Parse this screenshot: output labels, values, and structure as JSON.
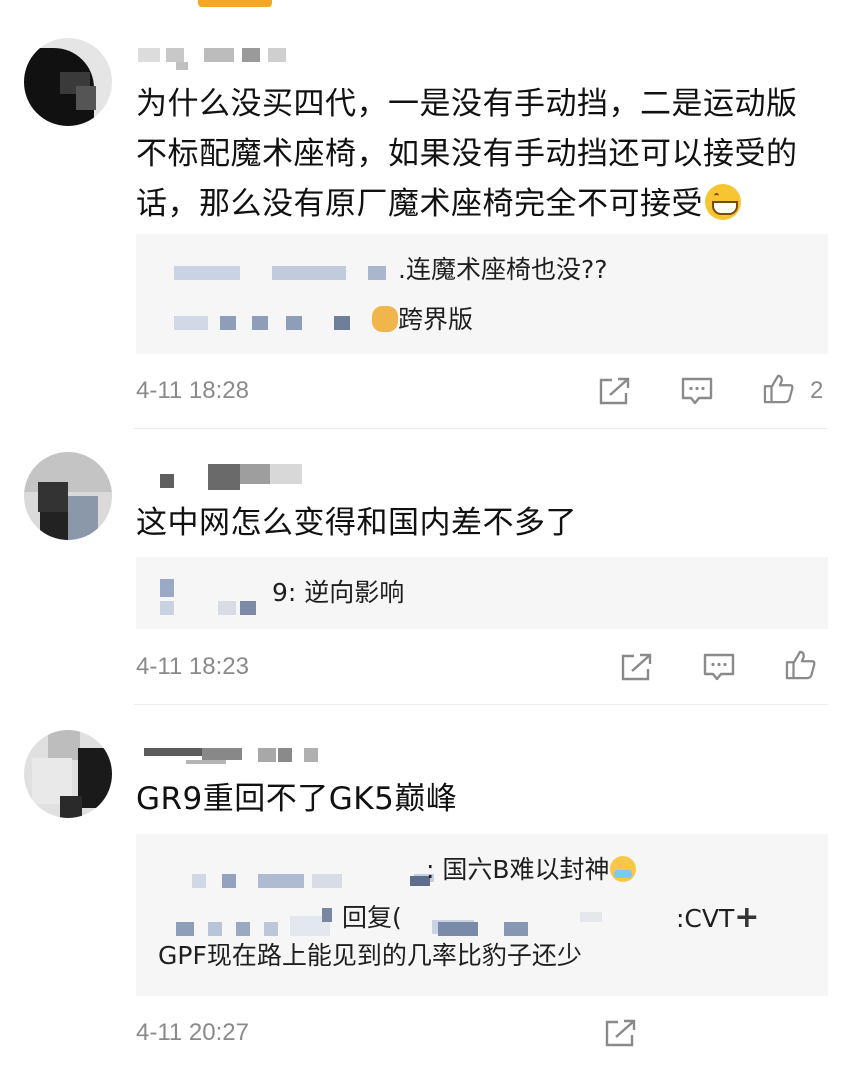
{
  "comments": [
    {
      "body_lines": [
        "为什么没买四代，一是没有手动挡，二是运动版",
        "不标配魔术座椅，如果没有手动挡还可以接受的",
        "话，那么没有原厂魔术座椅完全不可接受"
      ],
      "replies": [
        ".连魔术座椅也没??",
        "跨界版"
      ],
      "time": "4-11 18:28",
      "like_count": "2"
    },
    {
      "body_lines": [
        "这中网怎么变得和国内差不多了"
      ],
      "replies": [
        "9: 逆向影响"
      ],
      "time": "4-11 18:23",
      "like_count": ""
    },
    {
      "body_lines": [
        "GR9重回不了GK5巅峰"
      ],
      "replies": [
        ": 国六B难以封神",
        "回复(",
        ":CVT",
        "GPF现在路上能见到的几率比豹子还少"
      ],
      "time": "4-11 20:27",
      "like_count": ""
    }
  ],
  "icons": {
    "share": "share-icon",
    "comment": "comment-icon",
    "like": "thumbs-up-icon",
    "plus": "plus-icon"
  },
  "colors": {
    "accent_indicator": "#f5a623",
    "reply_background": "#f6f6f6",
    "meta_text": "#8a8a8a"
  }
}
